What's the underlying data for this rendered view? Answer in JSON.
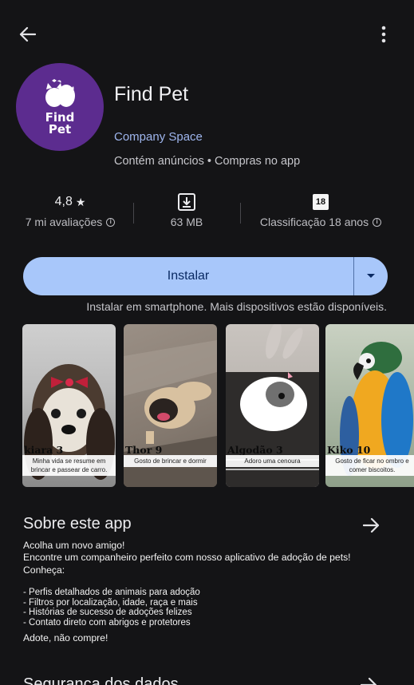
{
  "app": {
    "title": "Find Pet",
    "developer": "Company Space",
    "meta": "Contém anúncios  •  Compras no app",
    "icon_text_line1": "Find",
    "icon_text_line2": "Pet",
    "icon_color": "#5c2c8f"
  },
  "stats": {
    "rating_value": "4,8",
    "rating_label": "7 mi avaliações",
    "size_value": "63 MB",
    "age_badge": "18",
    "age_label": "Classificação 18 anos"
  },
  "install": {
    "label": "Instalar",
    "devices_note": "Instalar em smartphone. Mais dispositivos estão disponíveis.",
    "accent": "#a8c7fa"
  },
  "screenshots": [
    {
      "name": "kiara 3",
      "caption": "Minha vida se resume em brincar e passear de carro."
    },
    {
      "name": "Thor 9",
      "caption": "Gosto de brincar e dormir"
    },
    {
      "name": "Algodão 3",
      "caption": "Adoro uma cenoura"
    },
    {
      "name": "Kiko 10",
      "caption": "Gosto de ficar no ombro e comer biscoitos."
    }
  ],
  "about": {
    "title": "Sobre este app",
    "lines": [
      "Acolha um novo amigo!",
      "Encontre um companheiro perfeito com nosso aplicativo de adoção de pets!",
      "Conheça:"
    ],
    "features": [
      "- Perfis detalhados de animais para adoção",
      "- Filtros por localização, idade, raça e mais",
      "- Histórias de sucesso de adoções felizes",
      "- Contato direto com abrigos e protetores"
    ],
    "closing": "Adote, não compre!"
  },
  "next_section": {
    "title": "Segurança dos dados"
  }
}
